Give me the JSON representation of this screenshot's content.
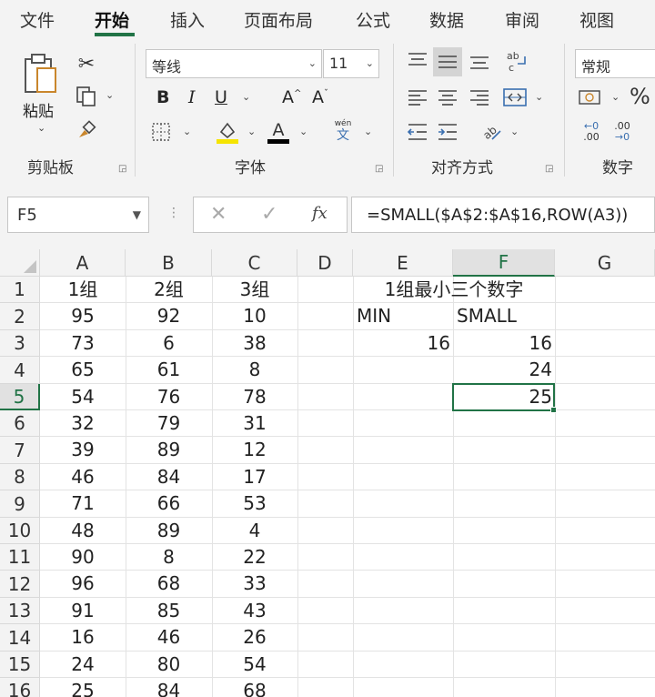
{
  "menu": {
    "tabs": [
      "文件",
      "开始",
      "插入",
      "页面布局",
      "公式",
      "数据",
      "审阅",
      "视图"
    ],
    "active_index": 1
  },
  "ribbon": {
    "clipboard": {
      "paste_label": "粘贴",
      "group_label": "剪贴板"
    },
    "font": {
      "font_name": "等线",
      "font_size": "11",
      "bold": "B",
      "italic": "I",
      "underline": "U",
      "grow": "A",
      "shrink": "A",
      "font_color_letter": "A",
      "phonetic_top": "wén",
      "phonetic_bottom": "文",
      "group_label": "字体",
      "highlight_color": "#f5e400",
      "font_color": "#000000"
    },
    "alignment": {
      "group_label": "对齐方式"
    },
    "number": {
      "format": "常规",
      "percent": "%",
      "group_label": "数字",
      "inc_decimal": ".00",
      "dec_decimal": ".00"
    }
  },
  "formula_bar": {
    "name_box": "F5",
    "fx": "fx",
    "formula": "=SMALL($A$2:$A$16,ROW(A3))"
  },
  "sheet": {
    "columns": [
      "A",
      "B",
      "C",
      "D",
      "E",
      "F",
      "G"
    ],
    "row_numbers": [
      "1",
      "2",
      "3",
      "4",
      "5",
      "6",
      "7",
      "8",
      "9",
      "10",
      "11",
      "12",
      "13",
      "14",
      "15",
      "16"
    ],
    "selected_cell": "F5",
    "cells": {
      "A": [
        "1组",
        "95",
        "73",
        "65",
        "54",
        "32",
        "39",
        "46",
        "71",
        "48",
        "90",
        "96",
        "91",
        "16",
        "24",
        "25"
      ],
      "B": [
        "2组",
        "92",
        "6",
        "61",
        "76",
        "79",
        "89",
        "84",
        "66",
        "89",
        "8",
        "68",
        "85",
        "46",
        "80",
        "84"
      ],
      "C": [
        "3组",
        "10",
        "38",
        "8",
        "78",
        "31",
        "12",
        "17",
        "53",
        "4",
        "22",
        "33",
        "43",
        "26",
        "54",
        "68"
      ],
      "E1F1": "1组最小三个数字",
      "E2": "MIN",
      "F2": "SMALL",
      "E3": "16",
      "F3": "16",
      "F4": "24",
      "F5": "25"
    },
    "accent_color": "#217346"
  }
}
